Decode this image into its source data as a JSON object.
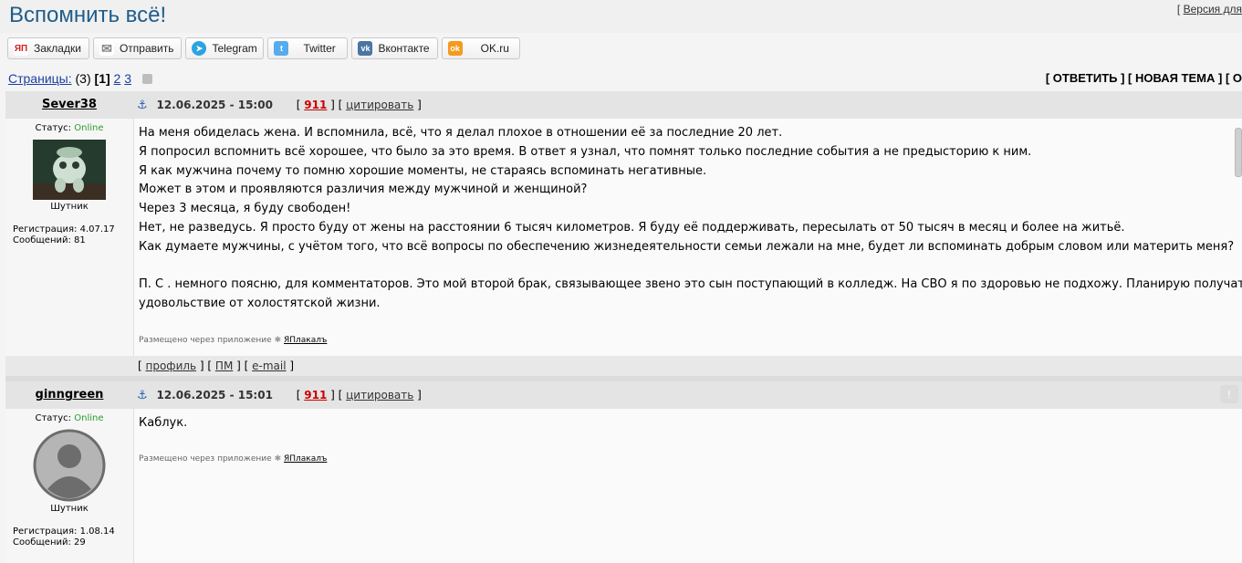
{
  "header": {
    "title": "Вспомнить всё!",
    "version_prefix": "[",
    "version_link": "Версия для"
  },
  "share": [
    {
      "label": "Закладки",
      "icon": "yp-icon",
      "color": "#d11f1f",
      "glyph": "ЯП"
    },
    {
      "label": "Отправить",
      "icon": "mail-icon",
      "color": "#888888",
      "glyph": "✉"
    },
    {
      "label": "Telegram",
      "icon": "telegram-icon",
      "color": "#2ba4e0",
      "glyph": "➤"
    },
    {
      "label": "Twitter",
      "icon": "twitter-icon",
      "color": "#55acee",
      "glyph": "t"
    },
    {
      "label": "Вконтакте",
      "icon": "vk-icon",
      "color": "#4c75a3",
      "glyph": "vk"
    },
    {
      "label": "OK.ru",
      "icon": "ok-icon",
      "color": "#f59a1e",
      "glyph": "ok"
    }
  ],
  "pager": {
    "label": "Страницы:",
    "count": "(3)",
    "current": "[1]",
    "pages": [
      "2",
      "3"
    ]
  },
  "actions": "[ ОТВЕТИТЬ ] [ НОВАЯ ТЕМА ] [ О",
  "posts": [
    {
      "author": "Sever38",
      "status_label": "Статус:",
      "status": "Online",
      "rank": "Шутник",
      "reg": "Регистрация: 4.07.17",
      "msgs": "Сообщений: 81",
      "datetime": "12.06.2025 - 15:00",
      "rating": "911",
      "quote": "цитировать",
      "lines": [
        "На меня обиделась жена. И вспомнила, всё, что я делал плохое в отношении её за последние 20 лет.",
        "Я попросил вспомнить всё хорошее, что было за это время. В ответ я узнал, что помнят только последние события а не предысторию к ним.",
        "Я как мужчина почему то помню хорошие моменты, не стараясь вспоминать негативные.",
        "Может в этом и проявляются различия между мужчиной и женщиной?",
        "Через 3 месяца, я буду свободен!",
        "Нет, не разведусь. Я просто буду от жены на расстоянии 6 тысяч километров. Я буду её поддерживать, пересылать от 50 тысяч в месяц и более на житьё.",
        "Как думаете мужчины, с учётом того, что всё вопросы по обеспечению жизнедеятельности семьи лежали на мне, будет ли вспоминать добрым словом или материть меня?",
        "",
        "П. С . немного поясню, для комментаторов. Это мой второй брак, связывающее звено это сын поступающий в колледж. На СВО я по здоровью не подхожу. Планирую получать",
        "удовольствие от холостятской жизни."
      ],
      "via": "Размещено через приложение",
      "via_app": "ЯПлакалъ",
      "footer": {
        "profile": "профиль",
        "pm": "ПМ",
        "email": "e-mail"
      }
    },
    {
      "author": "ginngreen",
      "status_label": "Статус:",
      "status": "Online",
      "rank": "Шутник",
      "reg": "Регистрация: 1.08.14",
      "msgs": "Сообщений: 29",
      "datetime": "12.06.2025 - 15:01",
      "rating": "911",
      "quote": "цитировать",
      "lines": [
        "Каблук."
      ],
      "via": "Размещено через приложение",
      "via_app": "ЯПлакалъ"
    }
  ]
}
